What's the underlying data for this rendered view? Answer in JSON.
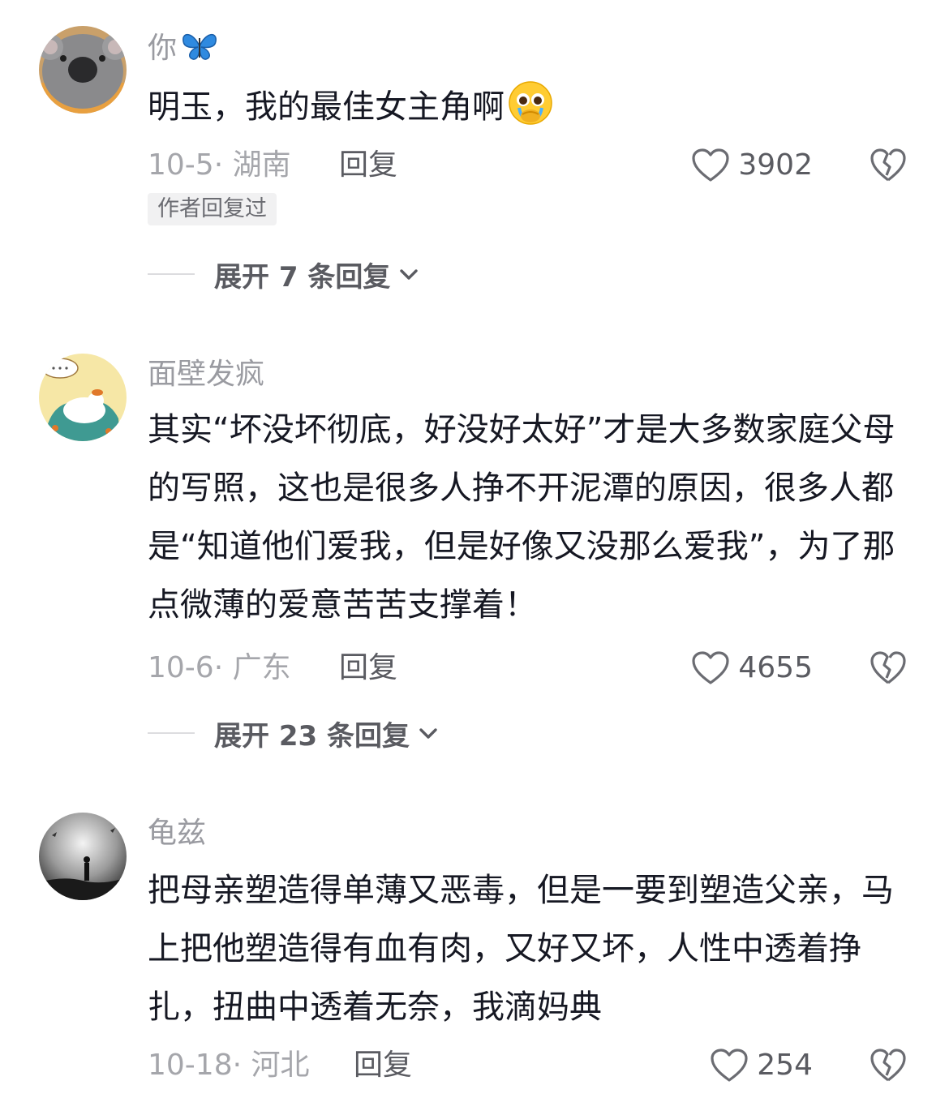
{
  "comments": [
    {
      "username": "你",
      "username_emoji": "blue-butterfly-icon",
      "text": "明玉，我的最佳女主角啊",
      "text_emoji": "pleading-face-icon",
      "date_location": "10-5· 湖南",
      "reply_label": "回复",
      "likes": "3902",
      "badge": "作者回复过",
      "expand_label": "展开 7 条回复"
    },
    {
      "username": "面壁发疯",
      "text": "其实“坏没坏彻底，好没好太好”才是大多数家庭父母的写照，这也是很多人挣不开泥潭的原因，很多人都是“知道他们爱我，但是好像又没那么爱我”，为了那点微薄的爱意苦苦支撑着！",
      "date_location": "10-6· 广东",
      "reply_label": "回复",
      "likes": "4655",
      "expand_label": "展开 23 条回复"
    },
    {
      "username": "龟兹",
      "text": "把母亲塑造得单薄又恶毒，但是一要到塑造父亲，马上把他塑造得有血有肉，又好又坏，人性中透着挣扎，扭曲中透着无奈，我滴妈典",
      "date_location": "10-18· 河北",
      "reply_label": "回复",
      "likes": "254"
    }
  ],
  "colors": {
    "text": "#161823",
    "username": "#9a9ba1",
    "meta": "#a5a6ab",
    "action": "#5a5b61",
    "badge_bg": "#f1f1f2"
  }
}
